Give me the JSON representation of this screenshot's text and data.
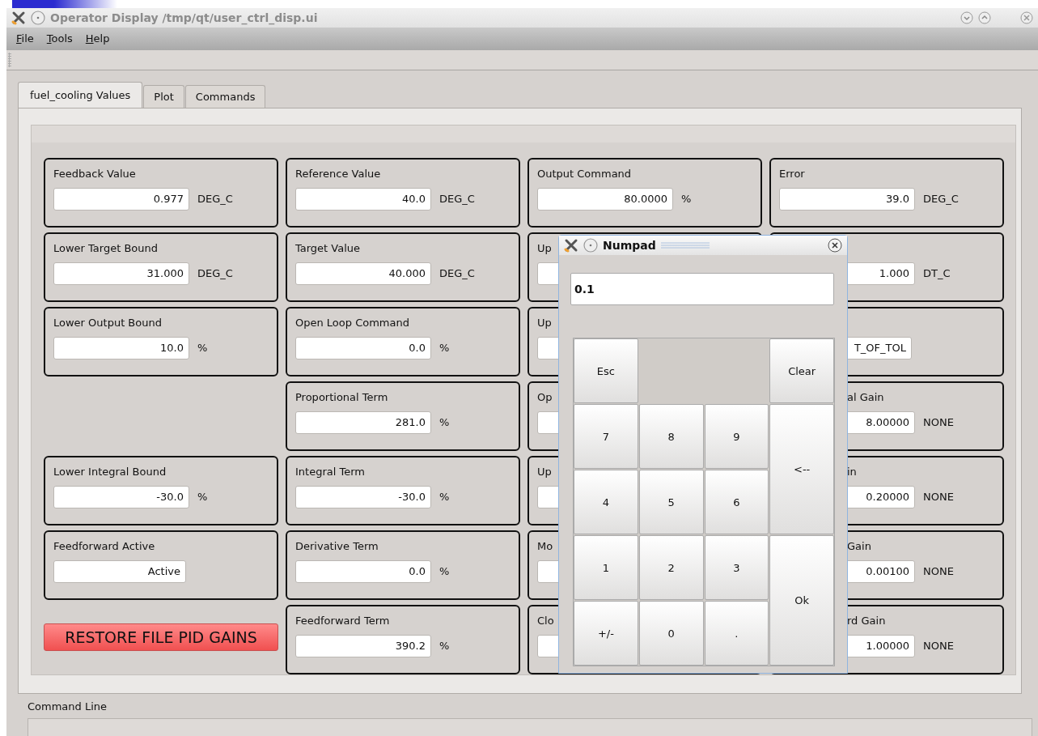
{
  "window": {
    "title": "Operator Display /tmp/qt/user_ctrl_disp.ui"
  },
  "menu": [
    {
      "label": "File"
    },
    {
      "label": "Tools"
    },
    {
      "label": "Help"
    }
  ],
  "tabs": [
    {
      "label": "fuel_cooling Values",
      "selected": true
    },
    {
      "label": "Plot",
      "selected": false
    },
    {
      "label": "Commands",
      "selected": false
    }
  ],
  "cards": [
    {
      "kind": "field",
      "label": "Feedback Value",
      "value": "0.977",
      "unit": "DEG_C"
    },
    {
      "kind": "field",
      "label": "Reference Value",
      "value": "40.0",
      "unit": "DEG_C"
    },
    {
      "kind": "field",
      "label": "Output Command",
      "value": "80.0000",
      "unit": "%"
    },
    {
      "kind": "field",
      "label": "Error",
      "value": "39.0",
      "unit": "DEG_C"
    },
    {
      "kind": "field",
      "label": "Lower Target Bound",
      "value": "31.000",
      "unit": "DEG_C"
    },
    {
      "kind": "field",
      "label": "Target Value",
      "value": "40.000",
      "unit": "DEG_C"
    },
    {
      "kind": "field",
      "label": "Up"
    },
    {
      "kind": "field",
      "value": "1.000",
      "unit": "DT_C"
    },
    {
      "kind": "field",
      "label": "Lower Output Bound",
      "value": "10.0",
      "unit": "%"
    },
    {
      "kind": "field",
      "label": "Open Loop Command",
      "value": "0.0",
      "unit": "%"
    },
    {
      "kind": "field",
      "label": "Up"
    },
    {
      "kind": "field",
      "value": "T_OF_TOL"
    },
    {
      "kind": "field",
      "label": "Proportional Term",
      "value": "281.0",
      "unit": "%"
    },
    {
      "kind": "field",
      "label": "Op"
    },
    {
      "kind": "field",
      "label": "al Gain",
      "partly_hidden": true,
      "value": "8.00000",
      "unit": "NONE"
    },
    {
      "kind": "field",
      "label": "Lower Integral Bound",
      "value": "-30.0",
      "unit": "%"
    },
    {
      "kind": "field",
      "label": "Integral Term",
      "value": "-30.0",
      "unit": "%"
    },
    {
      "kind": "field",
      "label": "Up"
    },
    {
      "kind": "field",
      "label": "in",
      "partly_hidden": true,
      "value": "0.20000",
      "unit": "NONE"
    },
    {
      "kind": "field",
      "label": "Feedforward Active",
      "value": "Active"
    },
    {
      "kind": "field",
      "label": "Derivative Term",
      "value": "0.0",
      "unit": "%"
    },
    {
      "kind": "field",
      "label": "Mo"
    },
    {
      "kind": "field",
      "label": "Gain",
      "partly_hidden": true,
      "value": "0.00100",
      "unit": "NONE"
    },
    {
      "kind": "button",
      "label": "RESTORE FILE PID GAINS"
    },
    {
      "kind": "field",
      "label": "Feedforward Term",
      "value": "390.2",
      "unit": "%"
    },
    {
      "kind": "field",
      "label": "Clo"
    },
    {
      "kind": "field",
      "label": "rd Gain",
      "partly_hidden": true,
      "value": "1.00000",
      "unit": "NONE"
    }
  ],
  "command_line": {
    "label": "Command Line"
  },
  "numpad": {
    "title": "Numpad",
    "display": "0.1",
    "keys": [
      {
        "kind": "key",
        "label": "Esc"
      },
      {
        "kind": "end",
        "label": "Clear"
      },
      {
        "kind": "key",
        "label": "7"
      },
      {
        "kind": "key",
        "label": "8"
      },
      {
        "kind": "key",
        "label": "9"
      },
      {
        "kind": "tall",
        "label": "<--"
      },
      {
        "kind": "key",
        "label": "4"
      },
      {
        "kind": "key",
        "label": "5"
      },
      {
        "kind": "key",
        "label": "6"
      },
      {
        "kind": "key",
        "label": "1"
      },
      {
        "kind": "key",
        "label": "2"
      },
      {
        "kind": "key",
        "label": "3"
      },
      {
        "kind": "tall",
        "label": "Ok"
      },
      {
        "kind": "key",
        "label": "+/-"
      },
      {
        "kind": "key",
        "label": "0"
      },
      {
        "kind": "key",
        "label": "."
      }
    ]
  }
}
